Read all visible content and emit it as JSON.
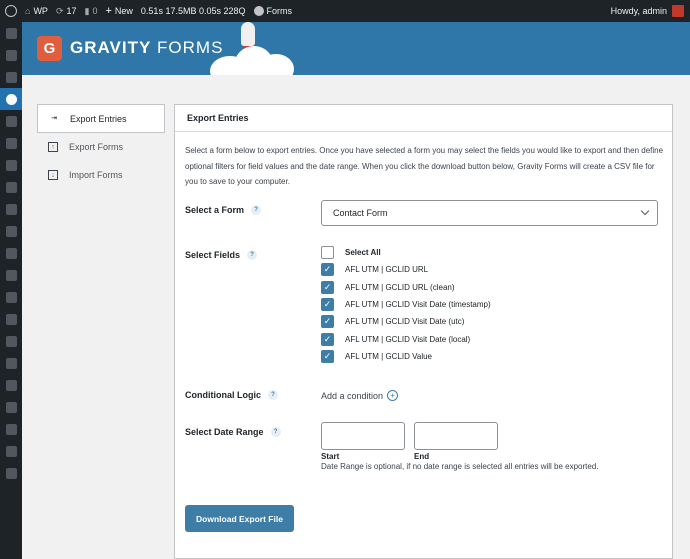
{
  "adminbar": {
    "site": "WP",
    "updates": "17",
    "comments": "0",
    "new": "New",
    "perf": "0.51s  17.5MB  0.05s  228Q",
    "plugin": "Forms",
    "howdy": "Howdy, admin"
  },
  "header": {
    "brand_bold": "GRAVITY",
    "brand_light": "FORMS"
  },
  "subnav": [
    {
      "label": "Export Entries",
      "icon": "export-entries-icon"
    },
    {
      "label": "Export Forms",
      "icon": "export-forms-icon"
    },
    {
      "label": "Import Forms",
      "icon": "import-forms-icon"
    }
  ],
  "panel": {
    "title": "Export Entries",
    "intro": "Select a form below to export entries. Once you have selected a form you may select the fields you would like to export and then define optional filters for field values and the date range. When you click the download button below, Gravity Forms will create a CSV file for you to save to your computer.",
    "select_form_label": "Select a Form",
    "selected_form": "Contact Form",
    "select_fields_label": "Select Fields",
    "fields": [
      {
        "label": "Select All",
        "checked": false
      },
      {
        "label": "AFL UTM | GCLID URL",
        "checked": true
      },
      {
        "label": "AFL UTM | GCLID URL (clean)",
        "checked": true
      },
      {
        "label": "AFL UTM | GCLID Visit Date (timestamp)",
        "checked": true
      },
      {
        "label": "AFL UTM | GCLID Visit Date (utc)",
        "checked": true
      },
      {
        "label": "AFL UTM | GCLID Visit Date (local)",
        "checked": true
      },
      {
        "label": "AFL UTM | GCLID Value",
        "checked": true
      }
    ],
    "conditional_logic_label": "Conditional Logic",
    "add_condition": "Add a condition",
    "date_range_label": "Select Date Range",
    "start_label": "Start",
    "end_label": "End",
    "date_note": "Date Range is optional, if no date range is selected all entries will be exported.",
    "download_button": "Download Export File",
    "help": "?"
  },
  "colors": {
    "accent": "#3e7da6",
    "header": "#2f76a9",
    "adminbar": "#1d2327",
    "logo": "#e05e3d"
  }
}
